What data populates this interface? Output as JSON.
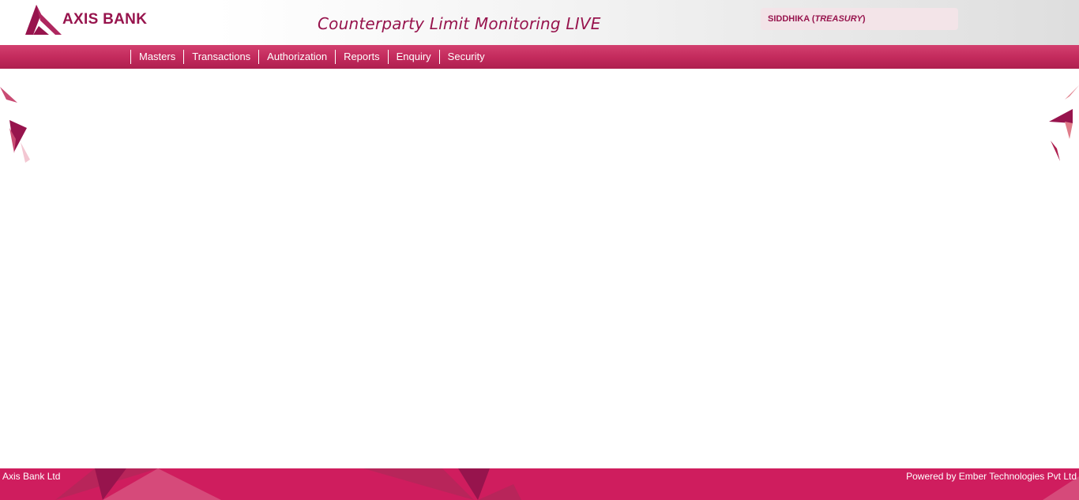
{
  "header": {
    "logo_text": "AXIS BANK",
    "app_title": "Counterparty Limit Monitoring LIVE",
    "user": {
      "name": "SIDDHIKA",
      "role": "TREASURY"
    }
  },
  "nav": {
    "items": [
      {
        "label": "Masters"
      },
      {
        "label": "Transactions"
      },
      {
        "label": "Authorization"
      },
      {
        "label": "Reports"
      },
      {
        "label": "Enquiry"
      },
      {
        "label": "Security"
      }
    ]
  },
  "footer": {
    "left_text": "Axis Bank Ltd",
    "right_text": "Powered by Ember Technologies Pvt Ltd"
  },
  "colors": {
    "brand": "#97144d",
    "nav_bar": "#c42b5d",
    "footer": "#cf1d5e"
  }
}
